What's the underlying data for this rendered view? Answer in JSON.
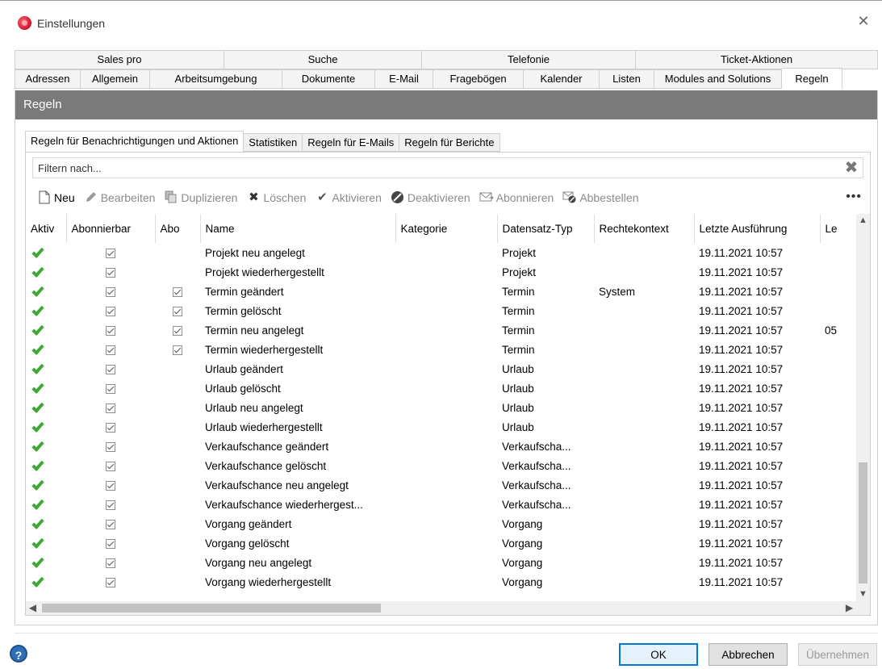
{
  "window": {
    "title": "Einstellungen",
    "close_glyph": "✕"
  },
  "tabs_row1": [
    "Sales pro",
    "Suche",
    "Telefonie",
    "Ticket-Aktionen"
  ],
  "tabs_row2": [
    "Adressen",
    "Allgemein",
    "Arbeitsumgebung",
    "Dokumente",
    "E-Mail",
    "Fragebögen",
    "Kalender",
    "Listen",
    "Modules and Solutions",
    "Regeln"
  ],
  "active_tab": "Regeln",
  "section_title": "Regeln",
  "subtabs": [
    "Regeln für Benachrichtigungen und Aktionen",
    "Statistiken",
    "Regeln für E-Mails",
    "Regeln für Berichte"
  ],
  "active_subtab": "Regeln für Benachrichtigungen und Aktionen",
  "filter": {
    "placeholder": "Filtern nach...",
    "clear_icon": "✖"
  },
  "toolbar": {
    "new": "Neu",
    "edit": "Bearbeiten",
    "duplicate": "Duplizieren",
    "delete": "Löschen",
    "activate": "Aktivieren",
    "deactivate": "Deaktivieren",
    "subscribe": "Abonnieren",
    "unsubscribe": "Abbestellen",
    "more": "•••"
  },
  "columns": [
    "Aktiv",
    "Abonnierbar",
    "Abo",
    "Name",
    "Kategorie",
    "Datensatz-Typ",
    "Rechtekontext",
    "Letzte Ausführung",
    "Le"
  ],
  "rows": [
    {
      "aktiv": true,
      "abonnierbar": true,
      "abo": false,
      "name": "Projekt neu angelegt",
      "kategorie": "",
      "typ": "Projekt",
      "kontext": "",
      "letzte": "19.11.2021 10:57",
      "le": ""
    },
    {
      "aktiv": true,
      "abonnierbar": true,
      "abo": false,
      "name": "Projekt wiederhergestellt",
      "kategorie": "",
      "typ": "Projekt",
      "kontext": "",
      "letzte": "19.11.2021 10:57",
      "le": ""
    },
    {
      "aktiv": true,
      "abonnierbar": true,
      "abo": true,
      "name": "Termin geändert",
      "kategorie": "",
      "typ": "Termin",
      "kontext": "System",
      "letzte": "19.11.2021 10:57",
      "le": ""
    },
    {
      "aktiv": true,
      "abonnierbar": true,
      "abo": true,
      "name": "Termin gelöscht",
      "kategorie": "",
      "typ": "Termin",
      "kontext": "",
      "letzte": "19.11.2021 10:57",
      "le": ""
    },
    {
      "aktiv": true,
      "abonnierbar": true,
      "abo": true,
      "name": "Termin neu angelegt",
      "kategorie": "",
      "typ": "Termin",
      "kontext": "",
      "letzte": "19.11.2021 10:57",
      "le": "05"
    },
    {
      "aktiv": true,
      "abonnierbar": true,
      "abo": true,
      "name": "Termin wiederhergestellt",
      "kategorie": "",
      "typ": "Termin",
      "kontext": "",
      "letzte": "19.11.2021 10:57",
      "le": ""
    },
    {
      "aktiv": true,
      "abonnierbar": true,
      "abo": false,
      "name": "Urlaub geändert",
      "kategorie": "",
      "typ": "Urlaub",
      "kontext": "",
      "letzte": "19.11.2021 10:57",
      "le": ""
    },
    {
      "aktiv": true,
      "abonnierbar": true,
      "abo": false,
      "name": "Urlaub gelöscht",
      "kategorie": "",
      "typ": "Urlaub",
      "kontext": "",
      "letzte": "19.11.2021 10:57",
      "le": ""
    },
    {
      "aktiv": true,
      "abonnierbar": true,
      "abo": false,
      "name": "Urlaub neu angelegt",
      "kategorie": "",
      "typ": "Urlaub",
      "kontext": "",
      "letzte": "19.11.2021 10:57",
      "le": ""
    },
    {
      "aktiv": true,
      "abonnierbar": true,
      "abo": false,
      "name": "Urlaub wiederhergestellt",
      "kategorie": "",
      "typ": "Urlaub",
      "kontext": "",
      "letzte": "19.11.2021 10:57",
      "le": ""
    },
    {
      "aktiv": true,
      "abonnierbar": true,
      "abo": false,
      "name": "Verkaufschance geändert",
      "kategorie": "",
      "typ": "Verkaufscha...",
      "kontext": "",
      "letzte": "19.11.2021 10:57",
      "le": ""
    },
    {
      "aktiv": true,
      "abonnierbar": true,
      "abo": false,
      "name": "Verkaufschance gelöscht",
      "kategorie": "",
      "typ": "Verkaufscha...",
      "kontext": "",
      "letzte": "19.11.2021 10:57",
      "le": ""
    },
    {
      "aktiv": true,
      "abonnierbar": true,
      "abo": false,
      "name": "Verkaufschance neu angelegt",
      "kategorie": "",
      "typ": "Verkaufscha...",
      "kontext": "",
      "letzte": "19.11.2021 10:57",
      "le": ""
    },
    {
      "aktiv": true,
      "abonnierbar": true,
      "abo": false,
      "name": "Verkaufschance wiederhergest...",
      "kategorie": "",
      "typ": "Verkaufscha...",
      "kontext": "",
      "letzte": "19.11.2021 10:57",
      "le": ""
    },
    {
      "aktiv": true,
      "abonnierbar": true,
      "abo": false,
      "name": "Vorgang geändert",
      "kategorie": "",
      "typ": "Vorgang",
      "kontext": "",
      "letzte": "19.11.2021 10:57",
      "le": ""
    },
    {
      "aktiv": true,
      "abonnierbar": true,
      "abo": false,
      "name": "Vorgang gelöscht",
      "kategorie": "",
      "typ": "Vorgang",
      "kontext": "",
      "letzte": "19.11.2021 10:57",
      "le": ""
    },
    {
      "aktiv": true,
      "abonnierbar": true,
      "abo": false,
      "name": "Vorgang neu angelegt",
      "kategorie": "",
      "typ": "Vorgang",
      "kontext": "",
      "letzte": "19.11.2021 10:57",
      "le": ""
    },
    {
      "aktiv": true,
      "abonnierbar": true,
      "abo": false,
      "name": "Vorgang wiederhergestellt",
      "kategorie": "",
      "typ": "Vorgang",
      "kontext": "",
      "letzte": "19.11.2021 10:57",
      "le": ""
    }
  ],
  "buttons": {
    "help": "?",
    "ok": "OK",
    "cancel": "Abbrechen",
    "apply": "Übernehmen"
  },
  "colors": {
    "section_header": "#7a7a7a",
    "active_check": "#3da833",
    "ok_border": "#0078d7",
    "help": "#2f6fb8"
  }
}
